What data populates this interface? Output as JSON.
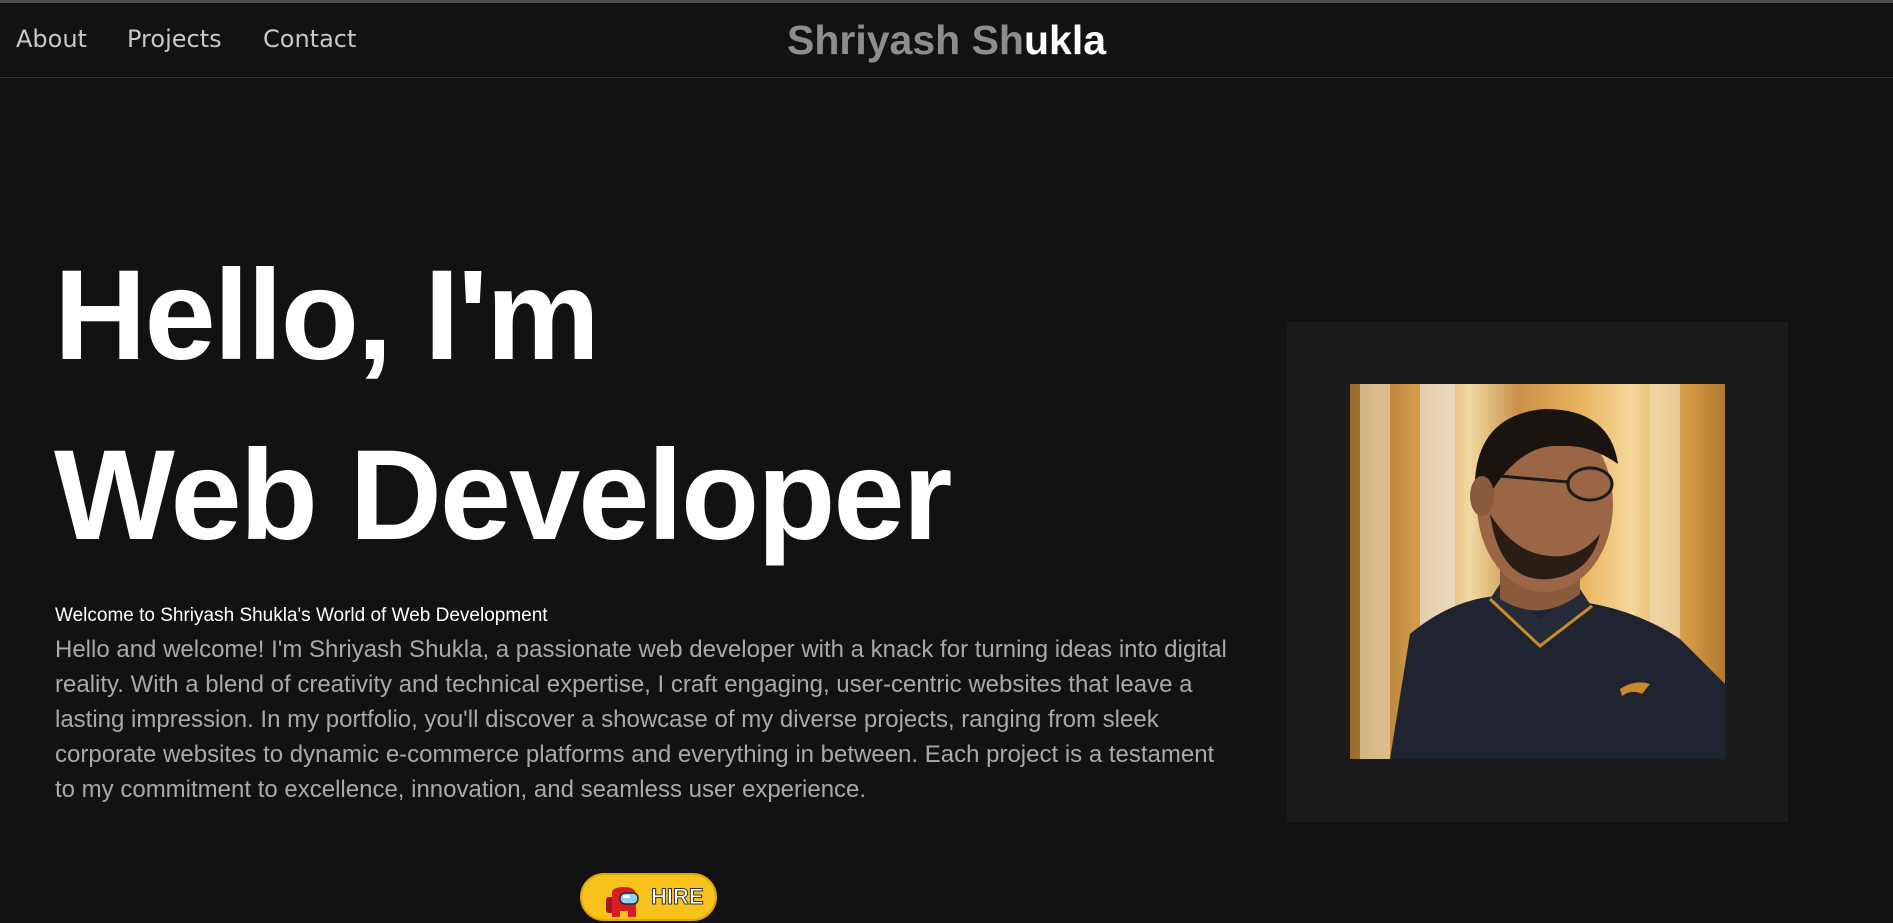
{
  "nav": {
    "links": [
      "About",
      "Projects",
      "Contact"
    ]
  },
  "brand": {
    "dim_part": "Shriyash Sh",
    "bright_part": "ukla"
  },
  "hero": {
    "line1": "Hello, I'm",
    "line2": "Web Developer"
  },
  "welcome_heading": "Welcome to Shriyash Shukla's World of Web Development",
  "intro_text": "Hello and welcome! I'm Shriyash Shukla, a passionate web developer with a knack for turning ideas into digital reality. With a blend of creativity and technical expertise, I craft engaging, user-centric websites that leave a lasting impression. In my portfolio, you'll discover a showcase of my diverse projects, ranging from sleek corporate websites to dynamic e-commerce platforms and everything in between. Each project is a testament to my commitment to excellence, innovation, and seamless user experience.",
  "hire_button": {
    "label": "HIRE",
    "icon": "crewmate-icon"
  },
  "colors": {
    "background": "#121212",
    "nav_text": "#c8c8c8",
    "hire_button_bg": "#f7c21b",
    "frame_bg": "#1b1b1b"
  }
}
